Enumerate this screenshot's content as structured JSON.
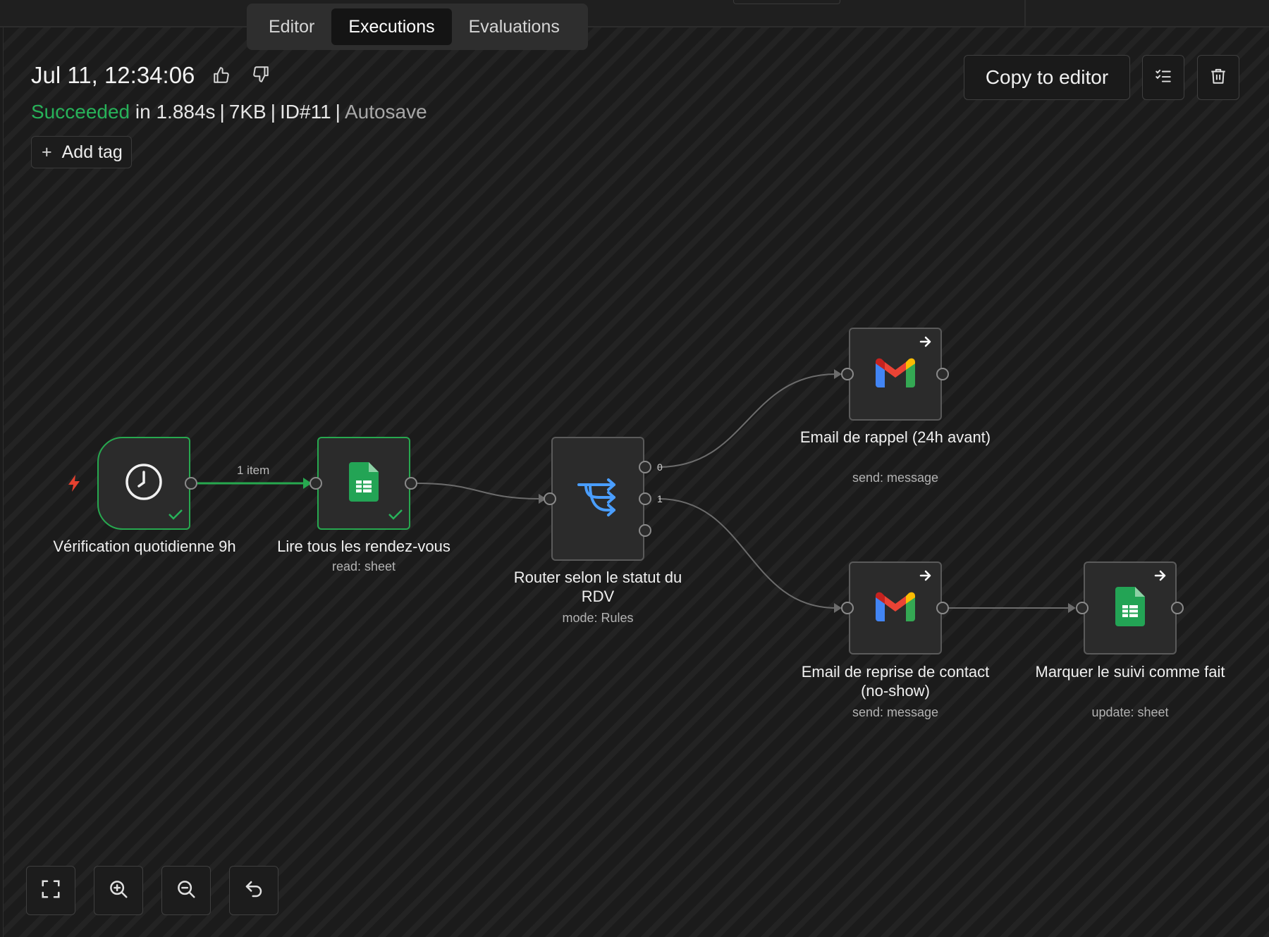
{
  "tabs": [
    {
      "label": "Editor",
      "active": false
    },
    {
      "label": "Executions",
      "active": true
    },
    {
      "label": "Evaluations",
      "active": false
    }
  ],
  "execution": {
    "title": "Jul 11, 12:34:06",
    "status": "Succeeded",
    "duration": "in 1.884s",
    "size": "7KB",
    "id": "ID#11",
    "mode": "Autosave",
    "add_tag_label": "Add tag"
  },
  "actions": {
    "copy_to_editor": "Copy to editor"
  },
  "nodes": {
    "trigger": {
      "label": "Vérification quotidienne 9h",
      "sub": ""
    },
    "read_sheet": {
      "label": "Lire tous les rendez-vous",
      "sub": "read: sheet"
    },
    "router": {
      "label": "Router selon le statut du RDV",
      "sub": "mode: Rules"
    },
    "email_reminder": {
      "label": "Email de rappel (24h avant)",
      "sub": "send: message"
    },
    "email_noshow": {
      "label": "Email de reprise de contact (no-show)",
      "sub": "send: message"
    },
    "mark_done": {
      "label": "Marquer le suivi comme fait",
      "sub": "update: sheet"
    }
  },
  "edge_labels": {
    "trigger_to_read": "1 item",
    "router_out_0": "0",
    "router_out_1": "1"
  },
  "colors": {
    "success": "#27b259",
    "accent_blue": "#4a9eff",
    "error_red": "#e5402f"
  },
  "icons": [
    "thumbs-up-icon",
    "thumbs-down-icon",
    "checklist-icon",
    "trash-icon",
    "clock-icon",
    "google-sheets-icon",
    "router-icon",
    "gmail-icon",
    "fit-view-icon",
    "zoom-in-icon",
    "zoom-out-icon",
    "undo-icon"
  ]
}
